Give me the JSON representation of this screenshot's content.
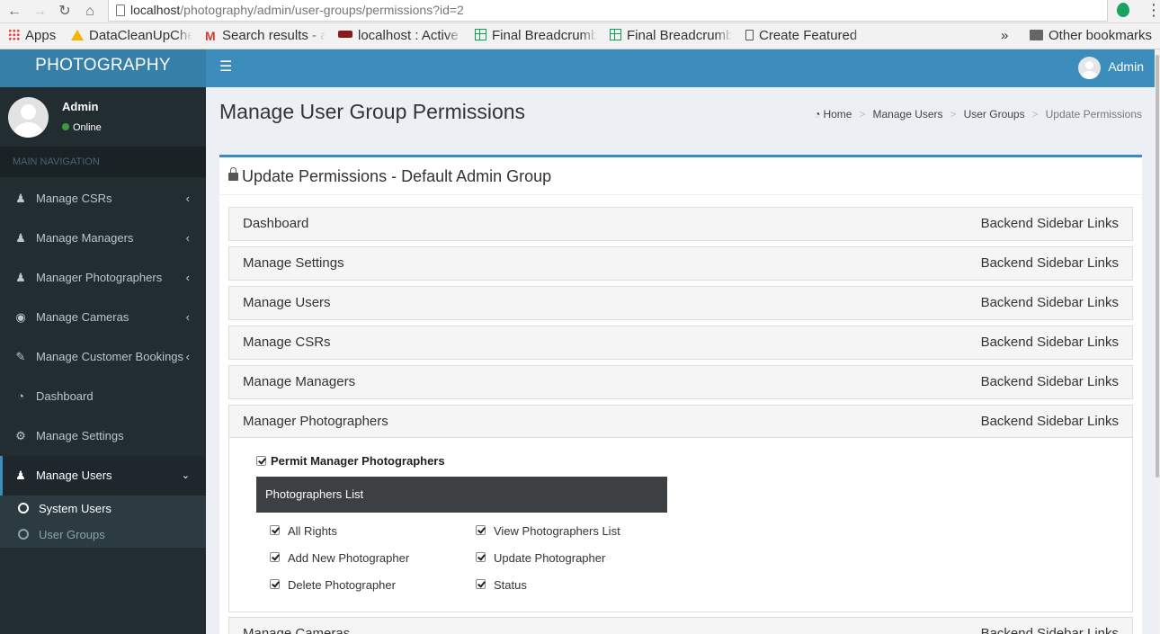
{
  "browser": {
    "url_host": "localhost",
    "url_path": "/photography/admin/user-groups/permissions?id=2",
    "bookmarks": [
      {
        "label": "Apps",
        "icon": "apps-grid-icon"
      },
      {
        "label": "DataCleanUpChe",
        "icon": "google-drive-icon"
      },
      {
        "label": "Search results - a",
        "icon": "gmail-icon"
      },
      {
        "label": "localhost : Active",
        "icon": "amo-icon"
      },
      {
        "label": "Final Breadcrumb",
        "icon": "sheets-icon"
      },
      {
        "label": "Final Breadcrumb",
        "icon": "sheets-icon"
      },
      {
        "label": "Create Featured",
        "icon": "page-icon"
      }
    ],
    "overflow_label": "»",
    "other_bookmarks": "Other bookmarks"
  },
  "app": {
    "logo": "PHOTOGRAPHY",
    "nav_user": "Admin"
  },
  "sidebar": {
    "user_name": "Admin",
    "user_status": "Online",
    "header": "MAIN NAVIGATION",
    "items": [
      {
        "label": "Manage CSRs",
        "icon": "user-icon"
      },
      {
        "label": "Manage Managers",
        "icon": "user-icon"
      },
      {
        "label": "Manager Photographers",
        "icon": "user-icon"
      },
      {
        "label": "Manage Cameras",
        "icon": "camera-icon"
      },
      {
        "label": "Manage Customer Bookings",
        "icon": "edit-icon"
      },
      {
        "label": "Dashboard",
        "icon": "dashboard-icon"
      },
      {
        "label": "Manage Settings",
        "icon": "gear-icon"
      },
      {
        "label": "Manage Users",
        "icon": "user-icon"
      }
    ],
    "subitems": [
      {
        "label": "System Users"
      },
      {
        "label": "User Groups"
      }
    ]
  },
  "content": {
    "title": "Manage User Group Permissions",
    "breadcrumb": [
      "Home",
      "Manage Users",
      "User Groups",
      "Update Permissions"
    ],
    "box_title": "Update Permissions - Default Admin Group",
    "sections": [
      {
        "title": "Dashboard",
        "tag": "Backend Sidebar Links"
      },
      {
        "title": "Manage Settings",
        "tag": "Backend Sidebar Links"
      },
      {
        "title": "Manage Users",
        "tag": "Backend Sidebar Links"
      },
      {
        "title": "Manage CSRs",
        "tag": "Backend Sidebar Links"
      },
      {
        "title": "Manage Managers",
        "tag": "Backend Sidebar Links"
      },
      {
        "title": "Manager Photographers",
        "tag": "Backend Sidebar Links"
      },
      {
        "title": "Manage Cameras",
        "tag": "Backend Sidebar Links"
      }
    ],
    "permit_label": "Permit Manager Photographers",
    "list_title": "Photographers List",
    "permissions": [
      "All Rights",
      "View Photographers List",
      "Add New Photographer",
      "Update Photographer",
      "Delete Photographer",
      "Status"
    ]
  },
  "colors": {
    "navbar": "#3c8dbc",
    "logo_bg": "#367fa9",
    "sidebar_bg": "#222d32",
    "content_bg": "#ecf0f5"
  }
}
